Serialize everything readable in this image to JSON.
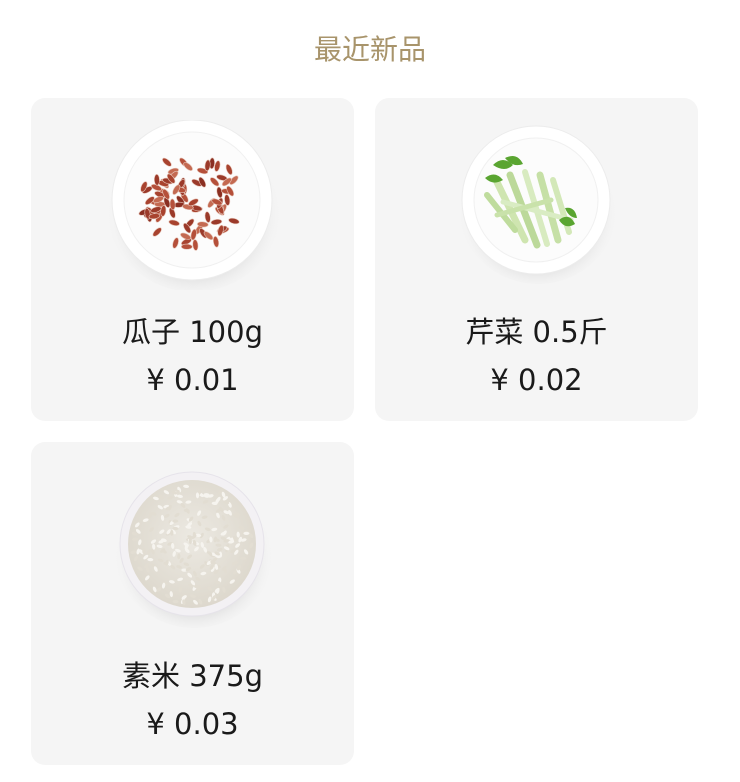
{
  "section": {
    "title": "最近新品"
  },
  "products": [
    {
      "name": "瓜子 100g",
      "price": "¥ 0.01",
      "image_icon": "sunflower-seeds-plate-image"
    },
    {
      "name": "芹菜 0.5斤",
      "price": "¥ 0.02",
      "image_icon": "celery-plate-image"
    },
    {
      "name": "素米 375g",
      "price": "¥ 0.03",
      "image_icon": "rice-plate-image"
    }
  ],
  "colors": {
    "title": "#a8946b",
    "card_background": "#f5f5f5",
    "text": "#1a1a1a"
  }
}
